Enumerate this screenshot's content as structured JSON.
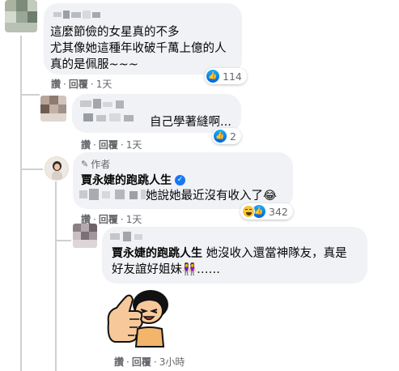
{
  "comments": [
    {
      "lines": [
        "這麼節儉的女星真的不多",
        "尤其像她這種年收破千萬上億的人",
        "真的是佩服~~~"
      ],
      "reaction_count": "114",
      "actions": {
        "like": "讚",
        "reply": "回覆",
        "time": "1天"
      }
    },
    {
      "text": "自己學著縫啊...",
      "reaction_count": "2",
      "actions": {
        "like": "讚",
        "reply": "回覆",
        "time": "1天"
      }
    },
    {
      "author_badge": "作者",
      "author": "賈永婕的跑跳人生",
      "text": "她說她最近沒有收入了😂",
      "reaction_count": "342",
      "actions": {
        "like": "讚",
        "reply": "回覆",
        "time": "1天"
      }
    },
    {
      "author_tag": "賈永婕的跑跳人生",
      "text_line1": "她沒收入還當神隊友，真是",
      "text_line2": "好友誼好姐妹👭……",
      "actions": {
        "like": "讚",
        "reply": "回覆",
        "time": "3小時"
      }
    }
  ],
  "icons": [
    "like-icon",
    "haha-icon",
    "verified-icon",
    "pencil-icon",
    "thumbs-up-sticker"
  ],
  "colors": {
    "bubble": "#f0f2f5",
    "like_blue": "#1877f2",
    "muted": "#65676b"
  }
}
